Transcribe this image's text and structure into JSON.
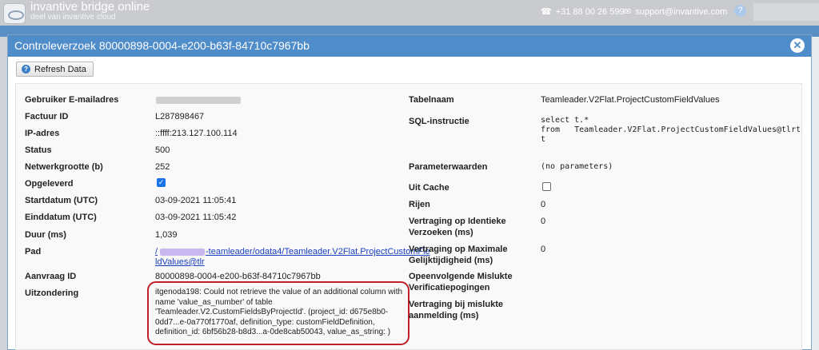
{
  "header": {
    "brand": "invantive bridge online",
    "brand_sub": "deel van invantive cloud",
    "phone": "+31 88 00 26 599",
    "email": "support@invantive.com",
    "help": "?"
  },
  "dialog": {
    "title": "Controleverzoek 80000898-0004-e200-b63f-84710c7967bb",
    "close": "✕",
    "refresh_label": "Refresh Data"
  },
  "left": {
    "email_label": "Gebruiker E-mailadres",
    "invoice_label": "Factuur ID",
    "invoice_value": "L287898467",
    "ip_label": "IP-adres",
    "ip_value": "::ffff:213.127.100.114",
    "status_label": "Status",
    "status_value": "500",
    "netsize_label": "Netwerkgrootte (b)",
    "netsize_value": "252",
    "delivered_label": "Opgeleverd",
    "start_label": "Startdatum (UTC)",
    "start_value": "03-09-2021 11:05:41",
    "end_label": "Einddatum (UTC)",
    "end_value": "03-09-2021 11:05:42",
    "duration_label": "Duur (ms)",
    "duration_value": "1,039",
    "path_label": "Pad",
    "path_line1": "-teamleader/odata4/Teamleader.V2Flat.ProjectCustomFie",
    "path_line2": "ldValues@tlr",
    "request_label": "Aanvraag ID",
    "request_value": "80000898-0004-e200-b63f-84710c7967bb",
    "exception_label": "Uitzondering",
    "exception_value": "itgenoda198: Could not retrieve the value of an additional column with name 'value_as_number' of table 'Teamleader.V2.CustomFieldsByProjectId'. (project_id: d675e8b0-0dd7...e-0a770f1770af, definition_type: customFieldDefinition, definition_id: 6bf56b28-b8d3...a-0de8cab50043, value_as_string: )"
  },
  "right": {
    "table_label": "Tabelnaam",
    "table_value": "Teamleader.V2Flat.ProjectCustomFieldValues",
    "sql_label": "SQL-instructie",
    "sql_line1": "select t.*",
    "sql_line2": "from   Teamleader.V2Flat.ProjectCustomFieldValues@tlrt",
    "sql_line3": "t",
    "params_label": "Parameterwaarden",
    "params_value": "(no parameters)",
    "cache_label": "Uit Cache",
    "rows_label": "Rijen",
    "rows_value": "0",
    "delay_identical_label_1": "Vertraging op Identieke",
    "delay_identical_label_2": "Verzoeken (ms)",
    "delay_identical_value": "0",
    "delay_max_label_1": "Vertraging op Maximale",
    "delay_max_label_2": "Gelijktijdigheid (ms)",
    "delay_max_value": "0",
    "failed_label_1": "Opeenvolgende Mislukte",
    "failed_label_2": "Verificatiepogingen",
    "delay_fail_label_1": "Vertraging bij mislukte",
    "delay_fail_label_2": "aanmelding (ms)"
  }
}
